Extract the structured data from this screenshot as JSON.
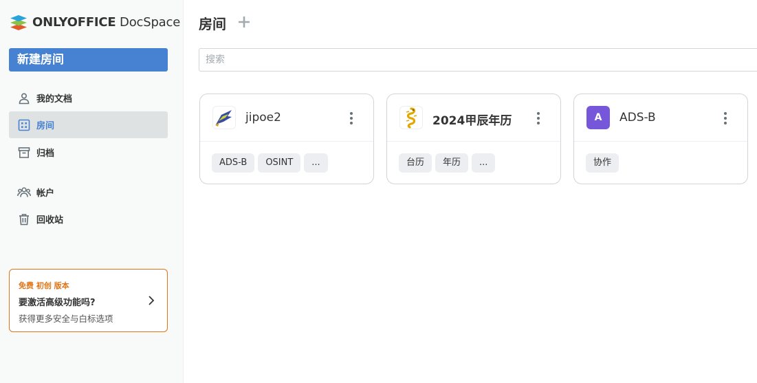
{
  "brand": {
    "name_bold": "ONLYOFFICE",
    "name_light": " DocSpace"
  },
  "sidebar": {
    "new_room_label": "新建房间",
    "items": [
      {
        "label": "我的文档",
        "icon": "user-icon",
        "active": false
      },
      {
        "label": "房间",
        "icon": "rooms-grid-icon",
        "active": true
      },
      {
        "label": "归档",
        "icon": "archive-icon",
        "active": false
      },
      {
        "label": "帐户",
        "icon": "people-icon",
        "active": false
      },
      {
        "label": "回收站",
        "icon": "trash-icon",
        "active": false
      }
    ],
    "promo": {
      "tag": "免费 初创 版本",
      "title": "要激活高级功能吗?",
      "subtitle": "获得更多安全与白标选项"
    }
  },
  "main": {
    "title": "房间",
    "search_placeholder": "搜索",
    "rooms": [
      {
        "title": "jipoe2",
        "logo": "image",
        "tags": [
          "ADS-B",
          "OSINT",
          "..."
        ]
      },
      {
        "title": "2024甲辰年历",
        "logo": "image",
        "tags": [
          "台历",
          "年历",
          "..."
        ]
      },
      {
        "title": "ADS-B",
        "logo": "letter",
        "logo_letter": "A",
        "tags": [
          "协作"
        ]
      }
    ]
  },
  "colors": {
    "accent": "#4781d1",
    "promo": "#e17415",
    "room_avatar": "#7757d9"
  }
}
